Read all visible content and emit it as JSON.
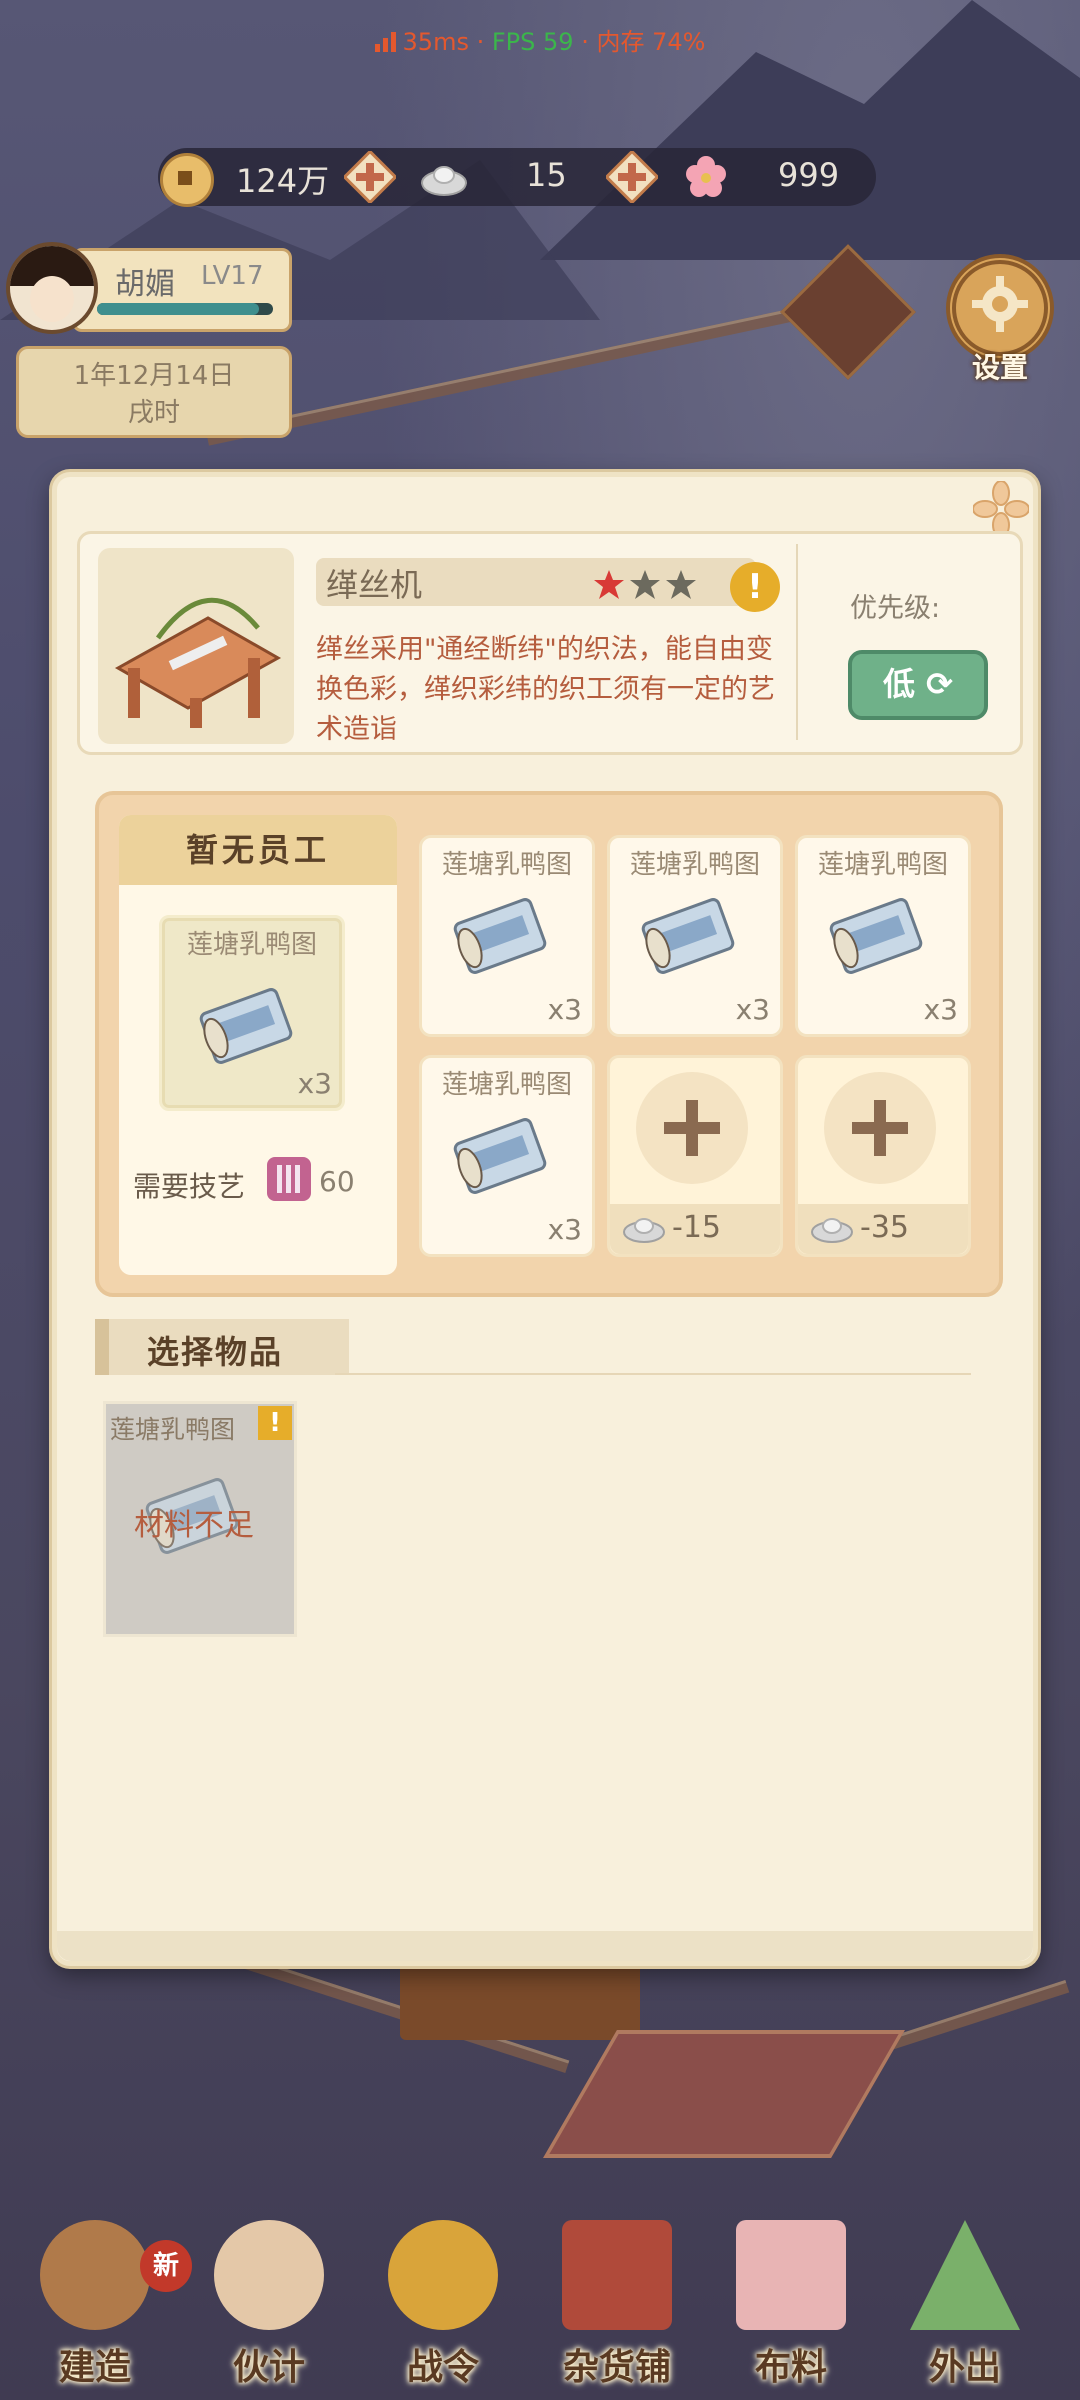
{
  "status_bar": {
    "ping": "35ms",
    "fps": "FPS 59",
    "memory": "内存 74%",
    "separator": "·"
  },
  "currency": {
    "coins": "124万",
    "silver": "15",
    "flowers": "999"
  },
  "player": {
    "name": "胡媚",
    "level": "LV17",
    "xp_fraction": 0.92
  },
  "date": {
    "line1": "1年12月14日",
    "line2": "戌时"
  },
  "settings": {
    "label": "设置"
  },
  "machine": {
    "name": "缂丝机",
    "stars_filled": 1,
    "stars_total": 3,
    "description": "缂丝采用\"通经断纬\"的织法，能自由变换色彩，缂织彩纬的织工须有一定的艺术造诣",
    "priority_label": "优先级:",
    "priority_value": "低"
  },
  "staff": {
    "header": "暂无员工",
    "slot": {
      "title": "莲塘乳鸭图",
      "count": "x3"
    },
    "skill_label": "需要技艺",
    "skill_value": "60"
  },
  "queue": [
    {
      "title": "莲塘乳鸭图",
      "count": "x3"
    },
    {
      "title": "莲塘乳鸭图",
      "count": "x3"
    },
    {
      "title": "莲塘乳鸭图",
      "count": "x3"
    },
    {
      "title": "莲塘乳鸭图",
      "count": "x3"
    }
  ],
  "add_slots": [
    {
      "cost": "-15"
    },
    {
      "cost": "-35"
    }
  ],
  "select": {
    "label": "选择物品",
    "items": [
      {
        "title": "莲塘乳鸭图",
        "status": "材料不足",
        "warn": "!"
      }
    ]
  },
  "nav": [
    {
      "label": "建造",
      "badge": "新"
    },
    {
      "label": "伙计"
    },
    {
      "label": "战令"
    },
    {
      "label": "杂货铺"
    },
    {
      "label": "布料"
    },
    {
      "label": "外出"
    }
  ],
  "colors": {
    "accent": "#6fb189",
    "warning": "#e6ad2a",
    "text_red": "#b55d3e",
    "star_filled": "#d83a36",
    "star_empty": "#6c6a5e"
  }
}
